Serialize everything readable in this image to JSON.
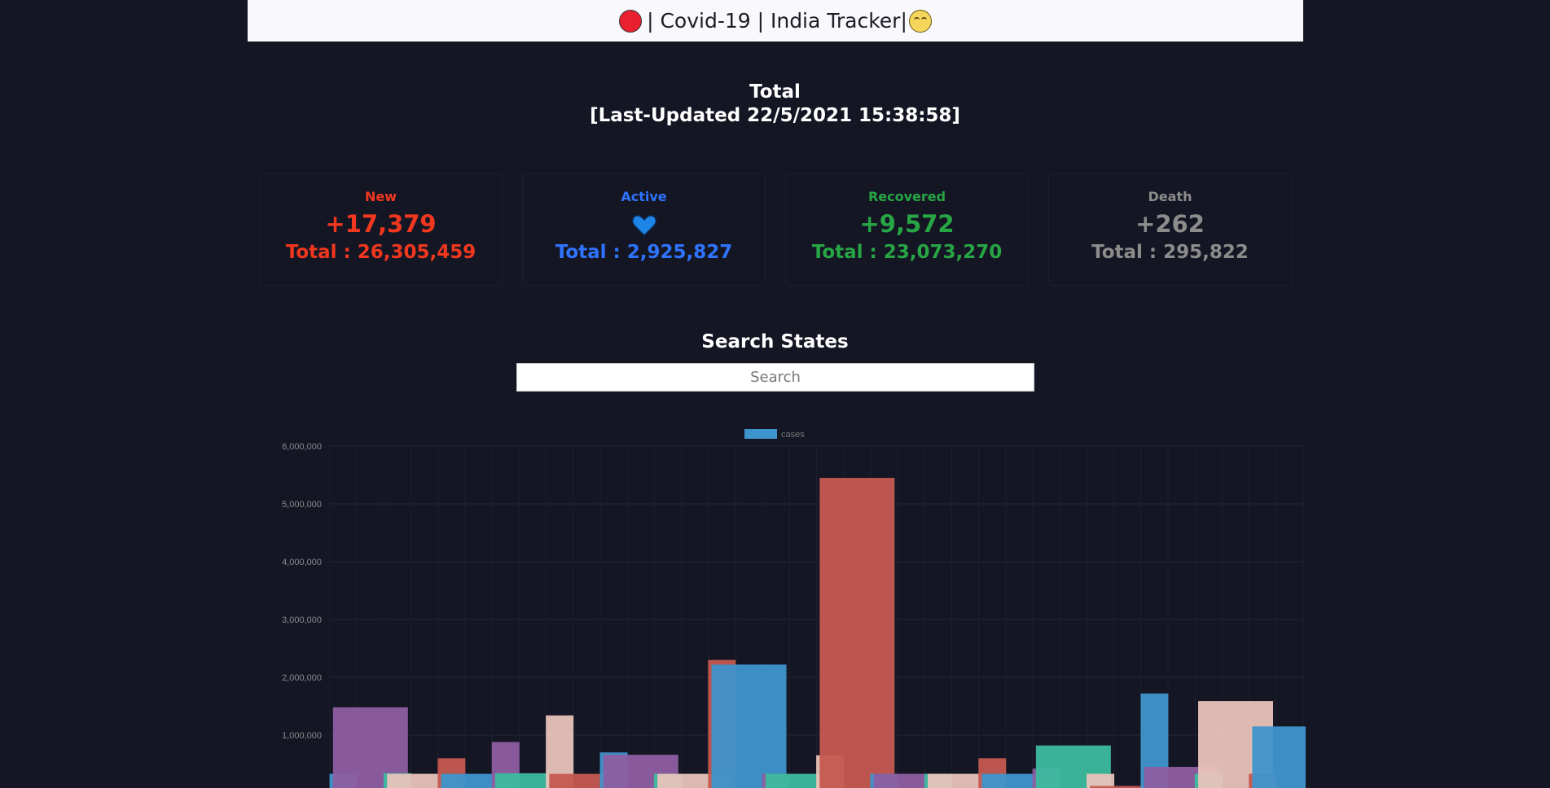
{
  "header": {
    "icon_left": "red-circle-icon",
    "title": " | Covid-19 | India Tracker|",
    "icon_right": "relieved-face-icon"
  },
  "summary": {
    "heading": "Total",
    "updated": "[Last-Updated 22/5/2021 15:38:58]"
  },
  "stats": [
    {
      "label": "New",
      "delta": "+17,379",
      "total": "Total : 26,305,459",
      "color": "#f2371f"
    },
    {
      "label": "Active",
      "delta_icon": "blue-heart-icon",
      "total": "Total : 2,925,827",
      "color": "#2f74ff"
    },
    {
      "label": "Recovered",
      "delta": "+9,572",
      "total": "Total : 23,073,270",
      "color": "#27a645"
    },
    {
      "label": "Death",
      "delta": "+262",
      "total": "Total : 295,822",
      "color": "#8c8c8c"
    }
  ],
  "search": {
    "title": "Search States",
    "placeholder": "Search"
  },
  "chart_data": {
    "type": "bar",
    "legend": "cases",
    "legend_position": "top",
    "ylim": [
      0,
      6000000
    ],
    "yticks": [
      "6,000,000",
      "5,000,000",
      "4,000,000",
      "3,000,000",
      "2,000,000",
      "1,000,000"
    ],
    "ytick_values": [
      6000000,
      5000000,
      4000000,
      3000000,
      2000000,
      1000000
    ],
    "grid": true,
    "palette": [
      "#3e95cd",
      "#8e5ea2",
      "#3cba9f",
      "#e8c3b9",
      "#c45850"
    ],
    "values": [
      330000,
      1480000,
      340000,
      330000,
      600000,
      330000,
      880000,
      340000,
      1340000,
      330000,
      700000,
      660000,
      330000,
      330000,
      2300000,
      2220000,
      330000,
      330000,
      650000,
      5450000,
      330000,
      330000,
      330000,
      330000,
      600000,
      330000,
      420000,
      820000,
      330000,
      120000,
      1720000,
      450000,
      330000,
      1590000,
      330000,
      1150000
    ]
  }
}
